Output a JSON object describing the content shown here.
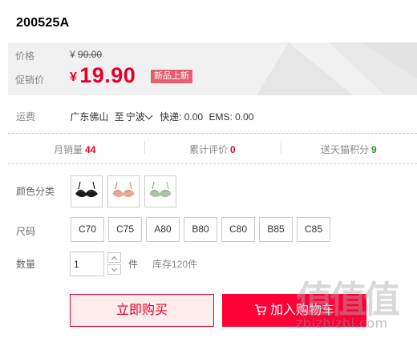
{
  "product": {
    "title": "200525A"
  },
  "price": {
    "label": "价格",
    "currency_symbol": "¥",
    "original": "90.00",
    "promo_label": "促销价",
    "promo_symbol": "¥",
    "promo": "19.90",
    "badge": "新品上新"
  },
  "shipping": {
    "label": "运费",
    "from": "广东佛山",
    "to_word": "至",
    "to": "宁波",
    "express": "快递: 0.00",
    "ems": "EMS: 0.00"
  },
  "stats": {
    "monthly_sales_label": "月销量",
    "monthly_sales": "44",
    "reviews_label": "累计评价",
    "reviews": "0",
    "points_label": "送天猫积分",
    "points": "9"
  },
  "color": {
    "label": "颜色分类",
    "options": [
      {
        "icon": "black-bra-icon",
        "color": "#1a1a1a"
      },
      {
        "icon": "pink-bra-icon",
        "color": "#e8a899"
      },
      {
        "icon": "green-bra-icon",
        "color": "#a9c4a6"
      }
    ]
  },
  "size": {
    "label": "尺码",
    "options": [
      "C70",
      "C75",
      "A80",
      "B80",
      "C80",
      "B85",
      "C85"
    ]
  },
  "quantity": {
    "label": "数量",
    "value": "1",
    "unit": "件",
    "stock": "库存120件"
  },
  "actions": {
    "buy_now": "立即购买",
    "add_to_cart": "加入购物车"
  },
  "watermark": {
    "glyphs": "值值值",
    "url": "zhizhizhi.com"
  },
  "colors": {
    "accent_red": "#e4002b",
    "cart_red": "#ff0036",
    "badge_pink": "#e4606f",
    "points_green": "#2f8f2f"
  }
}
